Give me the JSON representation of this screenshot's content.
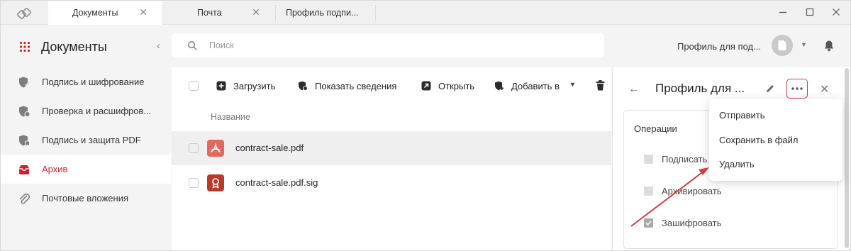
{
  "tabs": [
    {
      "label": "Документы",
      "active": true
    },
    {
      "label": "Почта",
      "active": false
    },
    {
      "label": "Профиль подпи...",
      "active": false
    }
  ],
  "sidebar": {
    "title": "Документы",
    "items": [
      {
        "label": "Подпись и шифрование",
        "icon": "shield-pen-icon",
        "active": false
      },
      {
        "label": "Проверка и расшифров...",
        "icon": "shield-check-icon",
        "active": false
      },
      {
        "label": "Подпись и защита PDF",
        "icon": "shield-pdf-icon",
        "active": false
      },
      {
        "label": "Архив",
        "icon": "archive-icon",
        "active": true
      },
      {
        "label": "Почтовые вложения",
        "icon": "paperclip-icon",
        "active": false
      }
    ]
  },
  "search": {
    "placeholder": "Поиск"
  },
  "header": {
    "profile_name": "Профиль для под..."
  },
  "toolbar": {
    "upload": "Загрузить",
    "show_info": "Показать сведения",
    "open": "Открыть",
    "add_to": "Добавить в"
  },
  "list": {
    "column_name": "Название",
    "files": [
      {
        "name": "contract-sale.pdf",
        "icon": "pdf-icon",
        "selected": true
      },
      {
        "name": "contract-sale.pdf.sig",
        "icon": "signature-icon",
        "selected": false
      }
    ]
  },
  "panel": {
    "title": "Профиль для ...",
    "operations_title": "Операции",
    "operations": [
      {
        "label": "Подписать",
        "checked": false
      },
      {
        "label": "Архивировать",
        "checked": false
      },
      {
        "label": "Зашифровать",
        "checked": true
      }
    ]
  },
  "menu": {
    "items": [
      "Отправить",
      "Сохранить в файл",
      "Удалить"
    ]
  },
  "colors": {
    "accent": "#c8262c",
    "pdf": "#e2695f",
    "sig": "#b83a2c"
  }
}
